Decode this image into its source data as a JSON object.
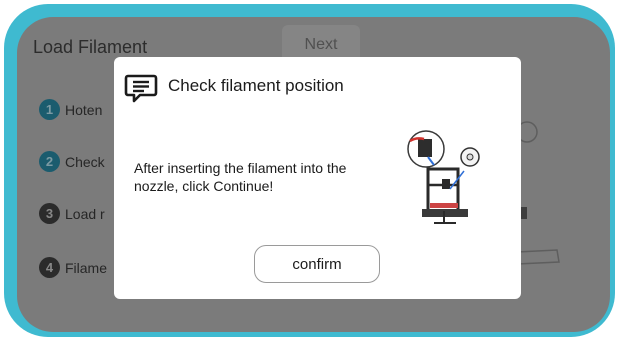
{
  "background_screen": {
    "title": "Load Filament",
    "next_label": "Next",
    "steps": [
      {
        "number": "1",
        "label": "Hoten",
        "active": true
      },
      {
        "number": "2",
        "label": "Check",
        "active": true
      },
      {
        "number": "3",
        "label": "Load r",
        "active": false
      },
      {
        "number": "4",
        "label": "Filame",
        "active": false
      }
    ]
  },
  "dialog": {
    "icon": "message-icon",
    "title": "Check filament position",
    "message": "After inserting the filament into the nozzle, click Continue!",
    "illustration": "printer-illustration",
    "confirm_label": "confirm"
  },
  "colors": {
    "frame": "#3fbad0",
    "overlay": "#7b7b7b",
    "dialog_bg": "#ffffff",
    "step_active": "#1b5c6e"
  }
}
